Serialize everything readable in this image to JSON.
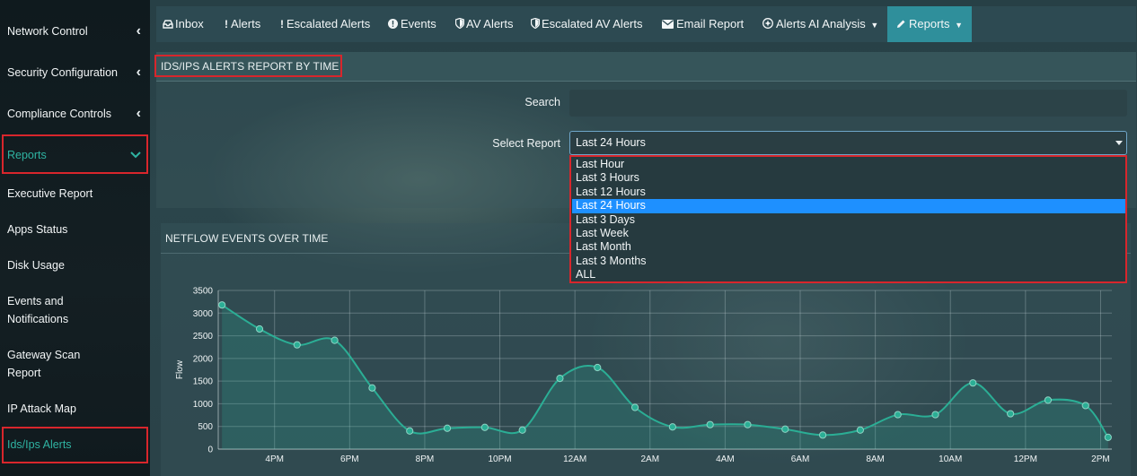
{
  "sidebar": {
    "items": [
      {
        "label": "Network Control",
        "chevron": "<"
      },
      {
        "label": "Security Configuration",
        "chevron": "<"
      },
      {
        "label": "Compliance Controls",
        "chevron": "<"
      },
      {
        "label": "Reports",
        "chevron": "v"
      },
      {
        "label": "Executive Report"
      },
      {
        "label": "Apps Status"
      },
      {
        "label": "Disk Usage"
      },
      {
        "label": "Events and Notifications"
      },
      {
        "label": "Gateway Scan Report"
      },
      {
        "label": "IP Attack Map"
      },
      {
        "label": "Ids/Ips Alerts"
      }
    ],
    "active_color": "#2fb3a2"
  },
  "topnav": {
    "items": [
      {
        "label": "Inbox",
        "icon": "inbox-icon"
      },
      {
        "label": "Alerts",
        "icon": "exclamation-icon"
      },
      {
        "label": "Escalated Alerts",
        "icon": "exclamation-icon"
      },
      {
        "label": "Events",
        "icon": "alert-circle-icon"
      },
      {
        "label": "AV Alerts",
        "icon": "shield-icon"
      },
      {
        "label": "Escalated AV Alerts",
        "icon": "shield-icon"
      },
      {
        "label": "Email Report",
        "icon": "envelope-icon"
      },
      {
        "label": "Alerts AI Analysis",
        "icon": "ai-icon"
      },
      {
        "label": "Reports",
        "icon": "pencil-icon"
      }
    ],
    "active_color": "#2f8f9b"
  },
  "report": {
    "title": "IDS/IPS ALERTS REPORT BY TIME",
    "search_label": "Search",
    "search_value": "",
    "select_label": "Select Report",
    "selected": "Last 24 Hours",
    "options": [
      "Last Hour",
      "Last 3 Hours",
      "Last 12 Hours",
      "Last 24 Hours",
      "Last 3 Days",
      "Last Week",
      "Last Month",
      "Last 3 Months",
      "ALL"
    ],
    "selected_color": "#1e90ff"
  },
  "chart": {
    "title": "NETFLOW EVENTS OVER TIME"
  },
  "chart_data": {
    "type": "area",
    "title": "NETFLOW EVENTS OVER TIME",
    "xlabel": "",
    "ylabel": "Flow",
    "ylim": [
      0,
      3500
    ],
    "yticks": [
      0,
      500,
      1000,
      1500,
      2000,
      2500,
      3000,
      3500
    ],
    "xtick_labels": [
      "4PM",
      "6PM",
      "8PM",
      "10PM",
      "12AM",
      "2AM",
      "4AM",
      "6AM",
      "8AM",
      "10AM",
      "12PM",
      "2PM"
    ],
    "x_range_hours": [
      14.5,
      38.3
    ],
    "x_hours": [
      14.6,
      15.6,
      16.6,
      17.6,
      18.6,
      19.6,
      20.6,
      21.6,
      22.6,
      23.6,
      24.6,
      25.6,
      26.6,
      27.6,
      28.6,
      29.6,
      30.6,
      31.6,
      32.6,
      33.6,
      34.6,
      35.6,
      36.6,
      37.6,
      38.2
    ],
    "series": [
      {
        "name": "Flow",
        "color": "#2bae95",
        "values": [
          3180,
          2650,
          2300,
          2400,
          1350,
          400,
          460,
          480,
          420,
          1560,
          1800,
          920,
          490,
          540,
          540,
          440,
          310,
          420,
          760,
          760,
          1460,
          780,
          1080,
          960,
          260
        ]
      }
    ],
    "grid": true,
    "legend": "none"
  }
}
